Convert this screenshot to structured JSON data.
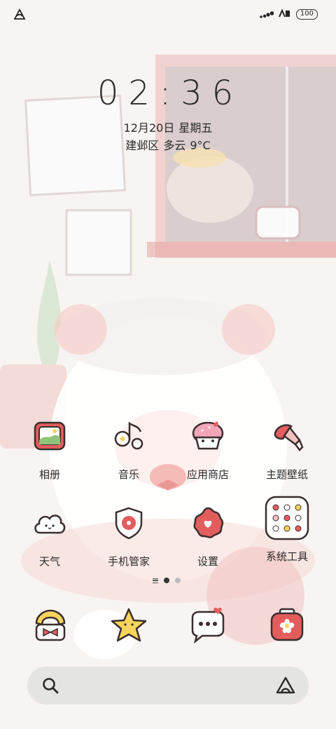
{
  "status_bar": {
    "battery": "100",
    "left_icon": "notification-app-icon",
    "right_icons": [
      "signal-icon",
      "data-icon"
    ]
  },
  "lock": {
    "time": "02:36",
    "date": "12月20日",
    "weekday": "星期五",
    "location": "建邺区",
    "weather": "多云",
    "temperature": "9°C"
  },
  "apps_row1": [
    {
      "label": "相册",
      "icon": "photo-album-icon"
    },
    {
      "label": "音乐",
      "icon": "music-note-icon"
    },
    {
      "label": "应用商店",
      "icon": "app-store-cupcake-icon"
    },
    {
      "label": "主题壁纸",
      "icon": "paintbrush-icon"
    }
  ],
  "apps_row2": [
    {
      "label": "天气",
      "icon": "cloud-icon"
    },
    {
      "label": "手机管家",
      "icon": "shield-icon"
    },
    {
      "label": "设置",
      "icon": "gear-flower-icon"
    },
    {
      "label": "系统工具",
      "icon": "folder-icon"
    }
  ],
  "dock": [
    {
      "icon": "phone-icon"
    },
    {
      "icon": "star-icon"
    },
    {
      "icon": "chat-bubble-icon"
    },
    {
      "icon": "camera-icon"
    }
  ],
  "colors": {
    "accent_red": "#e05a5a",
    "pink": "#f3b2ae",
    "outline": "#3a2e2e",
    "yellow": "#f6d55c"
  }
}
